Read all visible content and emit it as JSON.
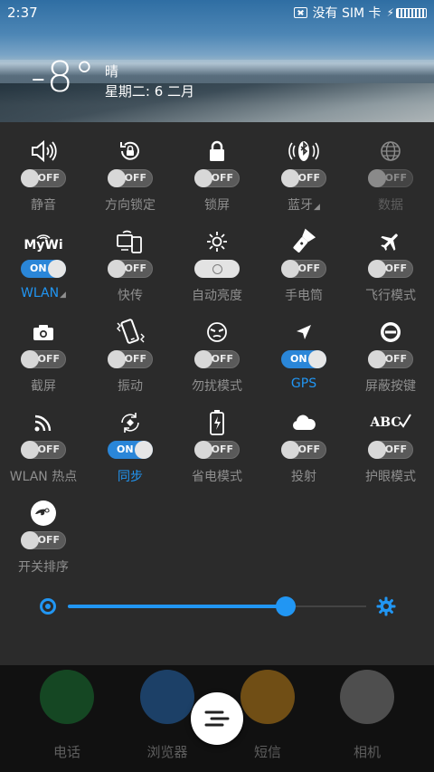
{
  "status": {
    "time": "2:37",
    "sim_text": "没有 SIM 卡"
  },
  "weather": {
    "temp": "-8°",
    "condition": "晴",
    "date": "星期二: 6 二月"
  },
  "tiles": [
    {
      "label": "静音",
      "state": "OFF",
      "icon": "speaker-icon"
    },
    {
      "label": "方向锁定",
      "state": "OFF",
      "icon": "rotation-lock-icon"
    },
    {
      "label": "锁屏",
      "state": "OFF",
      "icon": "lock-icon"
    },
    {
      "label": "蓝牙",
      "state": "OFF",
      "icon": "bluetooth-icon"
    },
    {
      "label": "数据",
      "state": "OFF",
      "icon": "globe-icon"
    },
    {
      "label": "WLAN",
      "state": "ON",
      "icon": "mywi-icon"
    },
    {
      "label": "快传",
      "state": "OFF",
      "icon": "transfer-icon"
    },
    {
      "label": "自动亮度",
      "state": "",
      "icon": "brightness-icon"
    },
    {
      "label": "手电筒",
      "state": "OFF",
      "icon": "flashlight-icon"
    },
    {
      "label": "飞行模式",
      "state": "OFF",
      "icon": "airplane-icon"
    },
    {
      "label": "截屏",
      "state": "OFF",
      "icon": "camera-icon"
    },
    {
      "label": "振动",
      "state": "OFF",
      "icon": "vibrate-icon"
    },
    {
      "label": "勿扰模式",
      "state": "OFF",
      "icon": "do-not-disturb-icon"
    },
    {
      "label": "GPS",
      "state": "ON",
      "icon": "location-arrow-icon"
    },
    {
      "label": "屏蔽按键",
      "state": "OFF",
      "icon": "block-keys-icon"
    },
    {
      "label": "WLAN 热点",
      "state": "OFF",
      "icon": "hotspot-icon"
    },
    {
      "label": "同步",
      "state": "ON",
      "icon": "sync-icon"
    },
    {
      "label": "省电模式",
      "state": "OFF",
      "icon": "battery-saver-icon"
    },
    {
      "label": "投射",
      "state": "OFF",
      "icon": "cloud-icon"
    },
    {
      "label": "护眼模式",
      "state": "OFF",
      "icon": "abc-check-icon"
    },
    {
      "label": "开关排序",
      "state": "OFF",
      "icon": "opensuse-icon"
    }
  ],
  "icon_text": {
    "mywi": "MyWi",
    "abc": "ABC"
  },
  "brightness": {
    "level": 0.73
  },
  "dock": [
    {
      "label": "电话",
      "color": "#1b8a3a"
    },
    {
      "label": "浏览器",
      "color": "#2a7bd0"
    },
    {
      "label": "短信",
      "color": "#e49a1a"
    },
    {
      "label": "相机",
      "color": "#9a9a9a"
    }
  ],
  "colors": {
    "accent": "#2196f3",
    "panel": "#2b2b2b"
  }
}
